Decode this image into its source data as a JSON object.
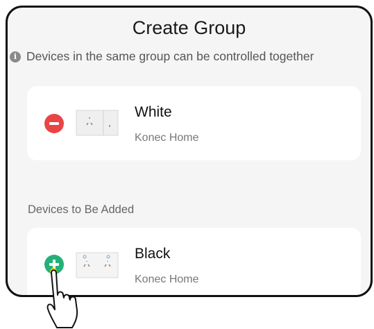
{
  "header": {
    "title": "Create Group"
  },
  "info": {
    "text": "Devices in the same group can be controlled together",
    "icon": "info-icon"
  },
  "group_devices": [
    {
      "name": "White",
      "home": "Konec Home",
      "action_icon": "remove-circle-icon",
      "thumb_icon": "white-socket-icon"
    }
  ],
  "section_label": "Devices to Be Added",
  "devices_to_add": [
    {
      "name": "Black",
      "home": "Konec Home",
      "action_icon": "add-circle-icon",
      "thumb_icon": "black-socket-icon"
    }
  ],
  "colors": {
    "remove": "#e94545",
    "add": "#25b07a",
    "background": "#f5f5f5",
    "card": "#ffffff"
  }
}
